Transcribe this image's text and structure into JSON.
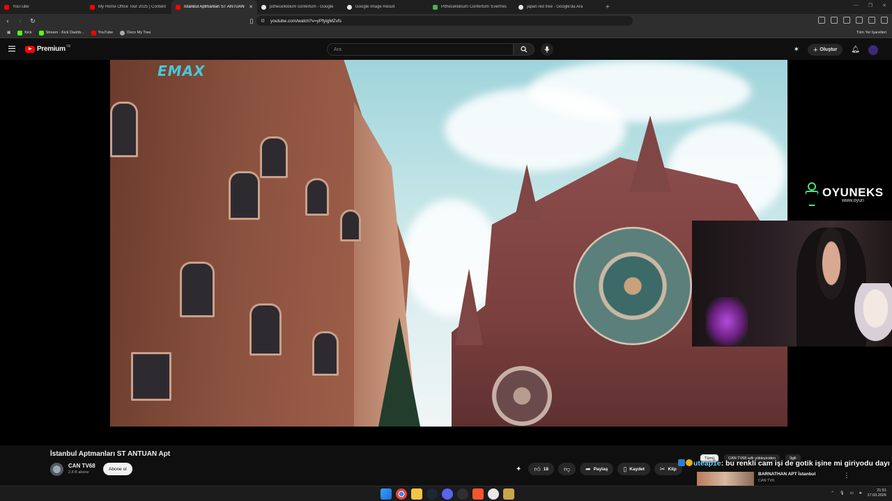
{
  "browser": {
    "tabs": [
      {
        "title": "YouTube",
        "color": "#ff0000",
        "active": false
      },
      {
        "title": "My Home Office Tour 2025 | Content",
        "color": "#ff0000",
        "active": false
      },
      {
        "title": "İstanbul Aptmanları ST ANTUAN",
        "color": "#ff0000",
        "active": true
      },
      {
        "title": "pithecellobium confertum - Google",
        "color": "#e8e8e8",
        "active": false
      },
      {
        "title": "Google Image Result",
        "color": "#e8e8e8",
        "active": false
      },
      {
        "title": "Pithecellobium Confertum 'Everfres",
        "color": "#4caf50",
        "active": false
      },
      {
        "title": "japan red tree - Google'da Ara",
        "color": "#e8e8e8",
        "active": false
      }
    ],
    "url": "youtube.com/watch?v=yPfylgMZvfs",
    "bookmarks": [
      {
        "label": "Kick",
        "color": "#53fc18"
      },
      {
        "label": "Stream - Kick Dashb...",
        "color": "#53fc18"
      },
      {
        "label": "YouTube",
        "color": "#ff0000"
      },
      {
        "label": "Deco My Tree",
        "color": "#aaaaaa"
      }
    ],
    "bookmarks_right": "Tüm Yer İşaretleri"
  },
  "youtube": {
    "logo_text": "Premium",
    "region": "TR",
    "search_placeholder": "Ara",
    "create_label": "Oluştur"
  },
  "video": {
    "channel_watermark": "EMAX",
    "sponsor_name": "OYUNEKS",
    "sponsor_url": "www.oyun",
    "title": "İstanbul Aptmanları ST ANTUAN Apt",
    "channel": "CAN TV68",
    "subscribers": "2,8 B abone",
    "subscribe_label": "Abone ol",
    "likes": "18",
    "share_label": "Paylaş",
    "save_label": "Kaydet",
    "clip_label": "Klip"
  },
  "recommendations": {
    "chips": [
      "Tümü",
      "CAN TV68 adlı yükleyiciden",
      "İlgili"
    ],
    "first": {
      "title": "BARNATHAN APT İstanbul",
      "channel": "CAN TV6"
    }
  },
  "chat": {
    "user": "uteap1e",
    "message": ": bu renkli cam işi de gotik işine mi giriyodu dayı"
  },
  "taskbar": {
    "time": "21:51",
    "date": "17.03.2026"
  }
}
